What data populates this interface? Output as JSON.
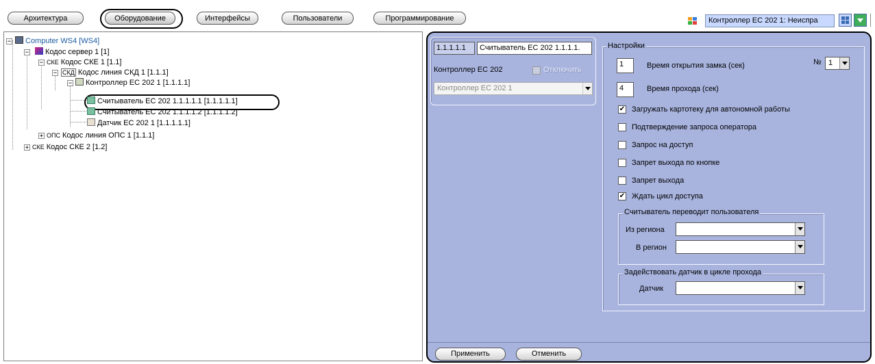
{
  "toolbar": {
    "tabs": [
      "Архитектура",
      "Оборудование",
      "Интерфейсы",
      "Пользователи",
      "Программирование"
    ],
    "status_text": "Контроллер ЕС 202 1: Неиспра"
  },
  "tree": {
    "nodes": [
      "Computer WS4 [WS4]",
      "Кодос сервер 1 [1]",
      "Кодос СКЕ 1 [1.1]",
      "Кодос линия СКД 1 [1.1.1]",
      "Контроллер ЕС 202 1 [1.1.1.1]",
      "Считыватель ЕС 202 1.1.1.1.1 [1.1.1.1.1]",
      "Считыватель ЕС 202 1.1.1.1.2 [1.1.1.1.2]",
      "Датчик ЕС 202 1 [1.1.1.1.1]",
      "Кодос линия ОПС 1 [1.1.1]",
      "Кодос СКЕ 2 [1.2]"
    ],
    "prefixes": {
      "ske": "СКЕ",
      "skd": "СКД",
      "ops": "ОПС"
    }
  },
  "object": {
    "id": "1.1.1.1.1",
    "name": "Считыватель ЕС 202 1.1.1.1.",
    "parent_label": "Контроллер ЕС 202",
    "disable_label": "Отключить",
    "parent_select": "Контроллер ЕС 202 1"
  },
  "settings": {
    "title": "Настройки",
    "lock_time_value": "1",
    "lock_time_label": "Время открытия замка (сек)",
    "number_label": "№",
    "number_value": "1",
    "pass_time_value": "4",
    "pass_time_label": "Время прохода (сек)",
    "checkboxes": [
      {
        "label": "Загружать картотеку для автономной работы",
        "checked": true
      },
      {
        "label": "Подтверждение запроса оператора",
        "checked": false
      },
      {
        "label": "Запрос на доступ",
        "checked": false
      },
      {
        "label": "Запрет выхода по кнопке",
        "checked": false
      },
      {
        "label": "Запрет выхода",
        "checked": false
      },
      {
        "label": "Ждать цикл доступа",
        "checked": true
      }
    ],
    "region_group": {
      "title": "Считыватель переводит пользователя",
      "from_label": "Из региона",
      "to_label": "В регион"
    },
    "sensor_group": {
      "title": "Задействовать датчик  в цикле прохода",
      "sensor_label": "Датчик"
    }
  },
  "buttons": {
    "apply": "Применить",
    "cancel": "Отменить"
  },
  "colors": {
    "panel_bg": "#a8b4de",
    "status_bg": "#c8d8ff"
  }
}
